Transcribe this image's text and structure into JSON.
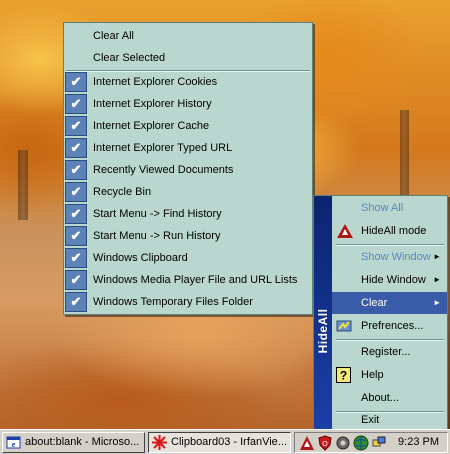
{
  "clear_menu": {
    "top_items": [
      {
        "label": "Clear All"
      },
      {
        "label": "Clear Selected"
      }
    ],
    "check_items": [
      {
        "label": "Internet Explorer Cookies",
        "checked": true
      },
      {
        "label": "Internet Explorer History",
        "checked": true
      },
      {
        "label": "Internet Explorer Cache",
        "checked": true
      },
      {
        "label": "Internet Explorer Typed URL",
        "checked": true
      },
      {
        "label": "Recently Viewed Documents",
        "checked": true
      },
      {
        "label": "Recycle Bin",
        "checked": true
      },
      {
        "label": "Start Menu -> Find History",
        "checked": true
      },
      {
        "label": "Start Menu -> Run History",
        "checked": true
      },
      {
        "label": "Windows Clipboard",
        "checked": true
      },
      {
        "label": "Windows Media Player File and URL Lists",
        "checked": true
      },
      {
        "label": "Windows Temporary Files Folder",
        "checked": true
      }
    ],
    "check_glyph": "✔"
  },
  "hideall_menu": {
    "sidebar_title": "HideAll",
    "items": {
      "show_all": "Show All",
      "hideall_mode": "HideAll mode",
      "show_window": "Show Window",
      "hide_window": "Hide Window",
      "clear": "Clear",
      "preferences": "Prefrences...",
      "register": "Register...",
      "help": "Help",
      "about": "About...",
      "exit": "Exit"
    },
    "submenu_arrow": "►"
  },
  "taskbar": {
    "tasks": [
      {
        "label": "about:blank - Microso..."
      },
      {
        "label": "Clipboard03 - IrfanVie..."
      }
    ],
    "clock": "9:23 PM"
  },
  "colors": {
    "menu_bg": "#bad7cf",
    "highlight": "#3a5ca8",
    "sidebar": "#1c3fa8"
  }
}
